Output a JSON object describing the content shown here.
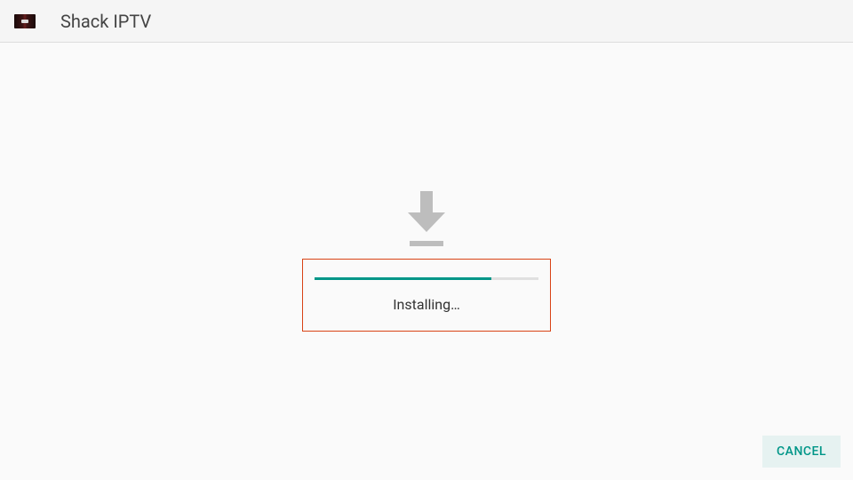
{
  "header": {
    "title": "Shack IPTV"
  },
  "install": {
    "status_text": "Installing…",
    "progress_percent": 79
  },
  "footer": {
    "cancel_label": "CANCEL"
  },
  "colors": {
    "accent": "#009688",
    "highlight_border": "#d84315"
  }
}
